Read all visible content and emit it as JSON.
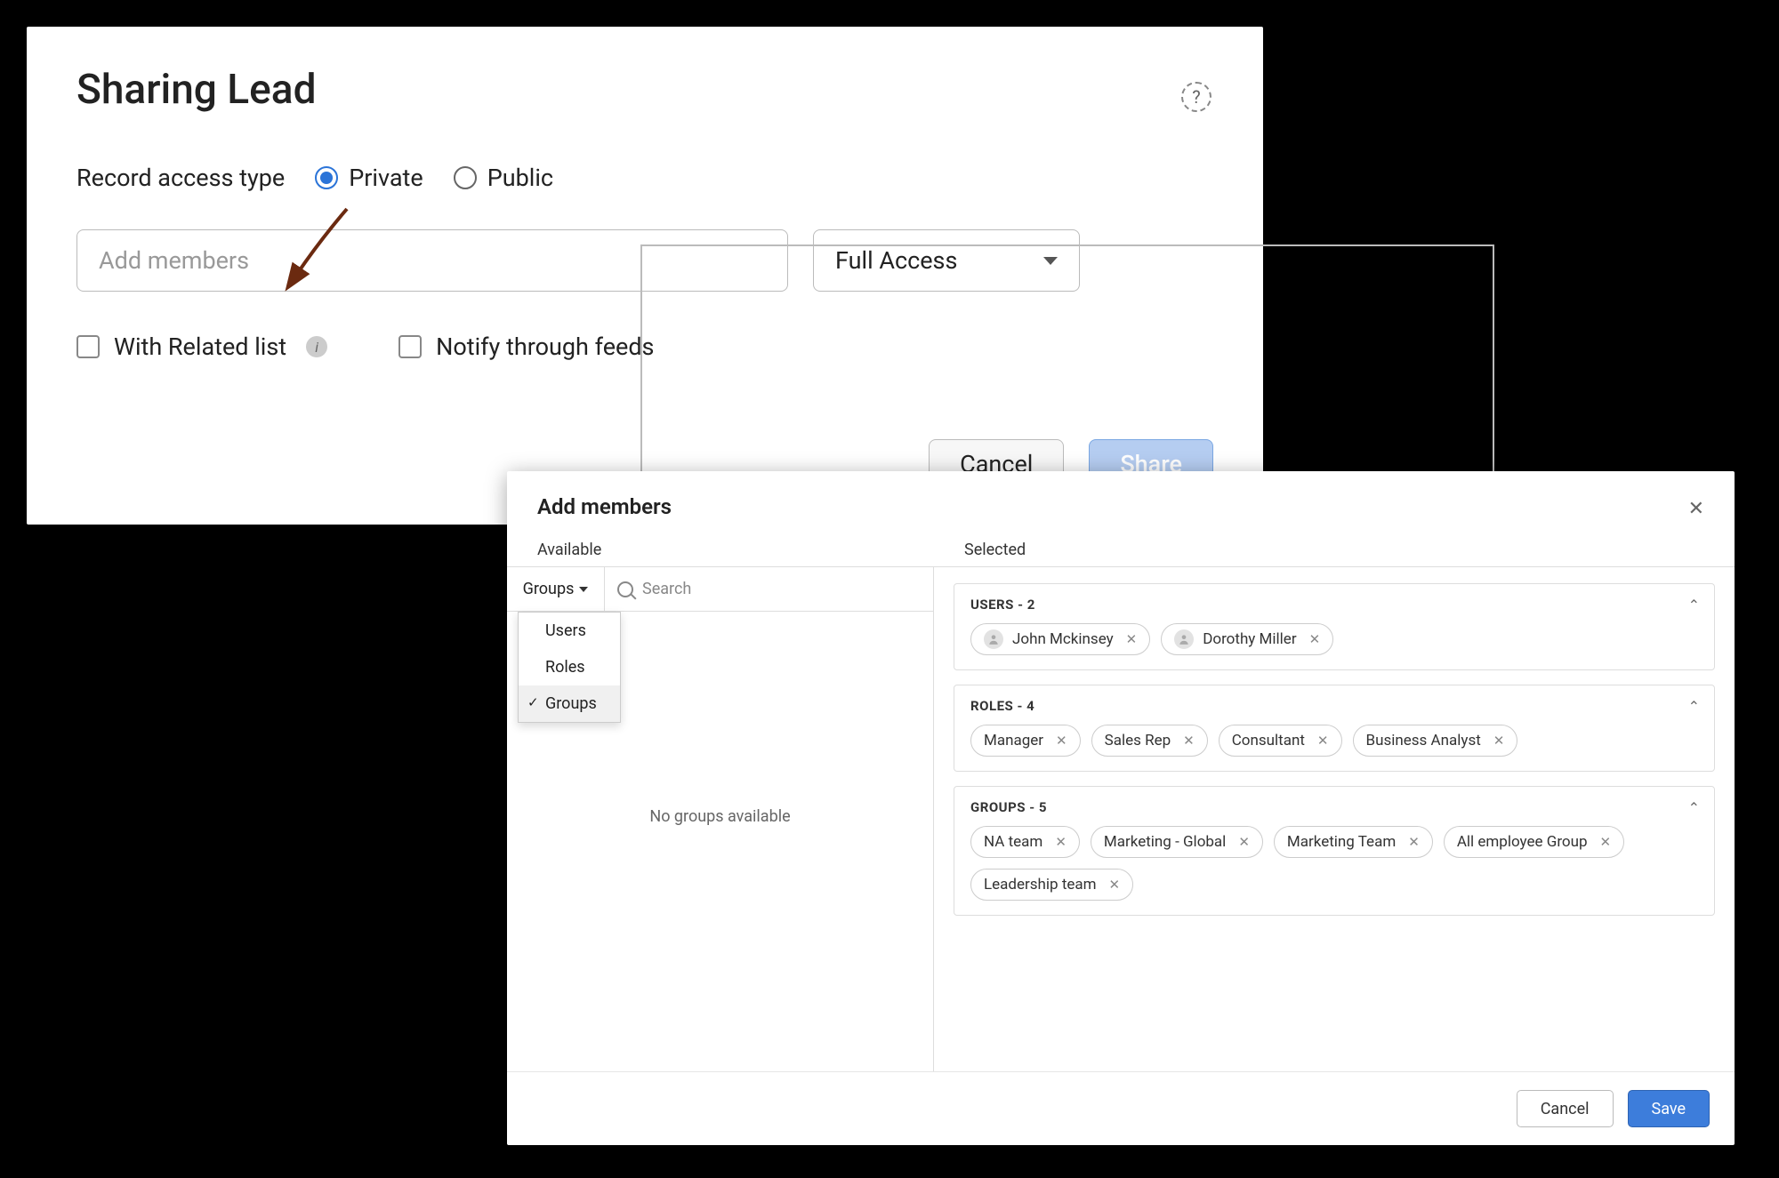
{
  "sharing": {
    "title": "Sharing Lead",
    "help_tooltip": "?",
    "access_type_label": "Record access type",
    "radio_private": "Private",
    "radio_public": "Public",
    "selected_radio": "private",
    "members_placeholder": "Add members",
    "access_level": "Full Access",
    "with_related": "With Related list",
    "notify_feeds": "Notify through feeds",
    "cancel": "Cancel",
    "share": "Share"
  },
  "addmembers": {
    "title": "Add members",
    "available_label": "Available",
    "selected_label": "Selected",
    "filter_label": "Groups",
    "filter_options": [
      "Users",
      "Roles",
      "Groups"
    ],
    "filter_selected": "Groups",
    "search_placeholder": "Search",
    "empty_msg": "No groups available",
    "cancel": "Cancel",
    "save": "Save",
    "selected": {
      "users": {
        "header": "USERS - 2",
        "items": [
          "John Mckinsey",
          "Dorothy Miller"
        ]
      },
      "roles": {
        "header": "ROLES - 4",
        "items": [
          "Manager",
          "Sales Rep",
          "Consultant",
          "Business Analyst"
        ]
      },
      "groups": {
        "header": "GROUPS - 5",
        "items": [
          "NA team",
          "Marketing - Global",
          "Marketing Team",
          "All employee Group",
          "Leadership team"
        ]
      }
    }
  }
}
